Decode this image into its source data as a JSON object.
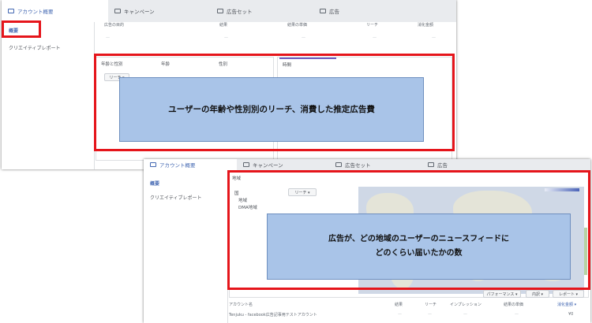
{
  "top_panel": {
    "tabs": [
      {
        "label": "アカウント概要",
        "icon": "account-overview-icon"
      },
      {
        "label": "キャンペーン",
        "icon": "folder-icon"
      },
      {
        "label": "広告セット",
        "icon": "grid-icon"
      },
      {
        "label": "広告",
        "icon": "ad-icon"
      }
    ],
    "sidebar": {
      "summary": "概要",
      "creative_report": "クリエイティブレポート"
    },
    "table_headers": [
      "広告の目的",
      "結果",
      "結果の単価",
      "リーチ",
      "消化金額"
    ],
    "dash": "—",
    "left_card_tabs": [
      "年齢と性別",
      "年齢",
      "性別"
    ],
    "left_card_button": "リーチ ▾",
    "right_card_tab": "時間",
    "annotation": "ユーザーの年齢や性別別のリーチ、消費した推定広告費"
  },
  "bottom_panel": {
    "tabs": [
      {
        "label": "アカウント概要",
        "icon": "account-overview-icon"
      },
      {
        "label": "キャンペーン",
        "icon": "folder-icon"
      },
      {
        "label": "広告セット",
        "icon": "grid-icon"
      },
      {
        "label": "広告",
        "icon": "ad-icon"
      }
    ],
    "sidebar": {
      "summary": "概要",
      "creative_report": "クリエイティブレポート"
    },
    "region_title": "地域",
    "region_options": [
      "国",
      "地域",
      "DMA地域"
    ],
    "reach_select": "リーチ ▾",
    "annotation_line1": "広告が、どの地域のユーザーのニュースフィードに",
    "annotation_line2": "どのくらい届いたかの数",
    "toolbar": {
      "performance": "パフォーマンス ▾",
      "contents": "内訳 ▾",
      "report": "レポート ▾"
    },
    "table_headers": [
      "アカウント名",
      "結果",
      "リーチ",
      "インプレッション",
      "結果の単価",
      "消化金額 ▾"
    ],
    "row_account": "Tenjuku - facebook広告記事用テストアカウント",
    "row_dash": "—",
    "row_amount": "¥0"
  },
  "colors": {
    "highlight": "#e5151b",
    "overlay": "#a9c4e8",
    "accent": "#4267b2"
  }
}
